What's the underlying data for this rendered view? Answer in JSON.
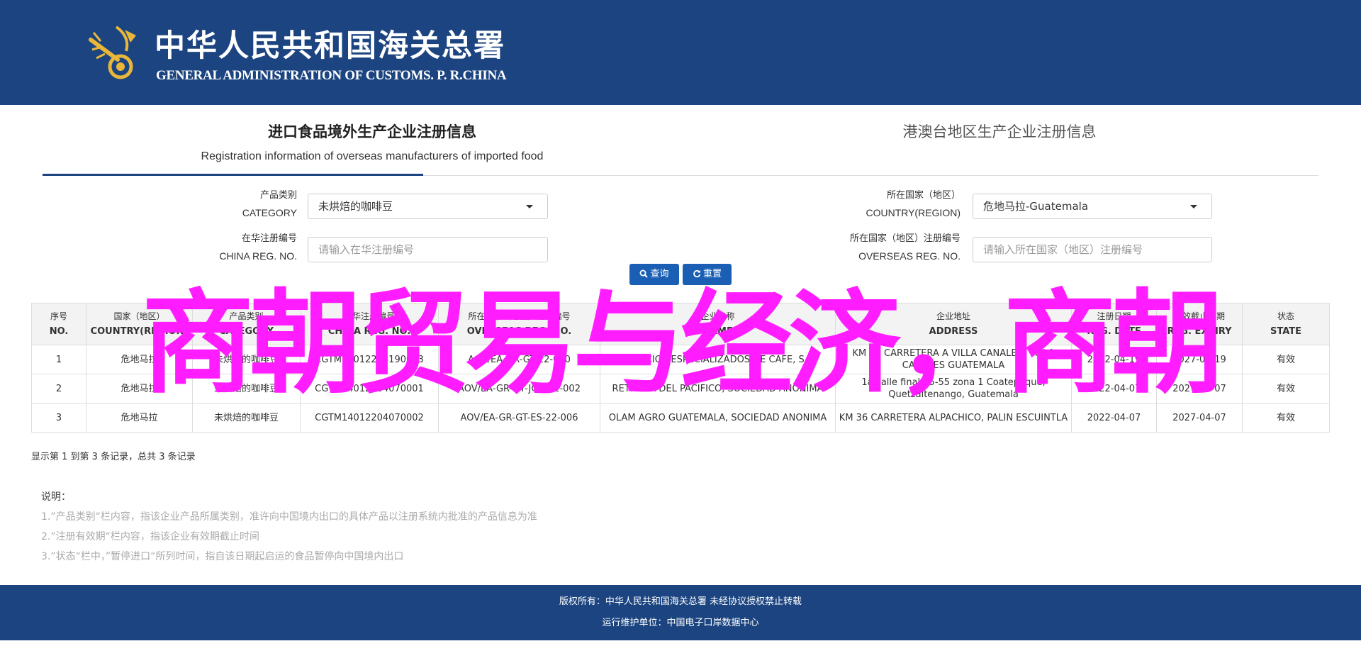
{
  "header": {
    "title_cn": "中华人民共和国海关总署",
    "title_en": "GENERAL ADMINISTRATION OF CUSTOMS. P. R.CHINA",
    "bg_color": "#1b4480"
  },
  "tabs": [
    {
      "label_cn": "进口食品境外生产企业注册信息",
      "label_en": "Registration information of overseas manufacturers of imported food",
      "active": true
    },
    {
      "label_cn": "港澳台地区生产企业注册信息",
      "active": false
    }
  ],
  "form": {
    "category": {
      "label_cn": "产品类别",
      "label_en": "CATEGORY",
      "value": "未烘焙的咖啡豆"
    },
    "country": {
      "label_cn": "所在国家（地区）",
      "label_en": "COUNTRY(REGION)",
      "value": "危地马拉-Guatemala"
    },
    "china_reg": {
      "label_cn": "在华注册编号",
      "label_en": "CHINA REG. NO.",
      "placeholder": "请输入在华注册编号"
    },
    "overseas_reg": {
      "label_cn": "所在国家（地区）注册编号",
      "label_en": "OVERSEAS REG. NO.",
      "placeholder": "请输入所在国家（地区）注册编号"
    },
    "search_label": "查询",
    "reset_label": "重置"
  },
  "table": {
    "columns": [
      {
        "cn": "序号",
        "en": "NO."
      },
      {
        "cn": "国家（地区）",
        "en": "COUNTRY(REGION)"
      },
      {
        "cn": "产品类别",
        "en": "CATEGORY"
      },
      {
        "cn": "在华注册编号",
        "en": "CHINA REG. NO."
      },
      {
        "cn": "所在国家（地区）注册编号",
        "en": "OVERSEAS REG. NO."
      },
      {
        "cn": "企业名称",
        "en": "NAME"
      },
      {
        "cn": "企业地址",
        "en": "ADDRESS"
      },
      {
        "cn": "注册日期",
        "en": "REG. DATE"
      },
      {
        "cn": "有效截止日期",
        "en": "REG. EXPIRY"
      },
      {
        "cn": "状态",
        "en": "STATE"
      }
    ],
    "rows": [
      [
        "1",
        "危地马拉",
        "未烘焙的咖啡豆",
        "CGTM14012204190003",
        "AOV/EA-GR-GT-22-010",
        "SERVICIOS ESPECIALIZADOS DE CAFE, S.A.",
        "KM 36 CARRETERA A VILLA CANALES, VILLA CANALES GUATEMALA",
        "2022-04-19",
        "2027-04-19",
        "有效"
      ],
      [
        "2",
        "危地马拉",
        "未烘焙的咖啡豆",
        "CGTM14012204070001",
        "AOV/EA-GR-GT-JQZ-22-002",
        "RETRILLA DEL PACIFICO, SOCIEDAD ANONIMA",
        "1a calle final 25-55 zona 1 Coatepeque, Quetzaltenango, Guatemala",
        "2022-04-07",
        "2027-04-07",
        "有效"
      ],
      [
        "3",
        "危地马拉",
        "未烘焙的咖啡豆",
        "CGTM14012204070002",
        "AOV/EA-GR-GT-ES-22-006",
        "OLAM AGRO GUATEMALA, SOCIEDAD ANONIMA",
        "KM 36 CARRETERA ALPACHICO, PALIN ESCUINTLA",
        "2022-04-07",
        "2027-04-07",
        "有效"
      ]
    ]
  },
  "pagination": {
    "text": "显示第 1 到第 3 条记录，总共 3 条记录"
  },
  "notes": {
    "title": "说明：",
    "items": [
      "1.”产品类别“栏内容，指该企业产品所属类别，准许向中国境内出口的具体产品以注册系统内批准的产品信息为准",
      "2.”注册有效期“栏内容，指该企业有效期截止时间",
      "3.”状态“栏中，”暂停进口“所列时间，指自该日期起启运的食品暂停向中国境内出口"
    ]
  },
  "footer": {
    "line1": "版权所有：中华人民共和国海关总署 未经协议授权禁止转载",
    "line2": "运行维护单位：中国电子口岸数据中心"
  },
  "overlay": {
    "text": "商朝贸易与经济，商朝",
    "color": "#ff1dff"
  }
}
